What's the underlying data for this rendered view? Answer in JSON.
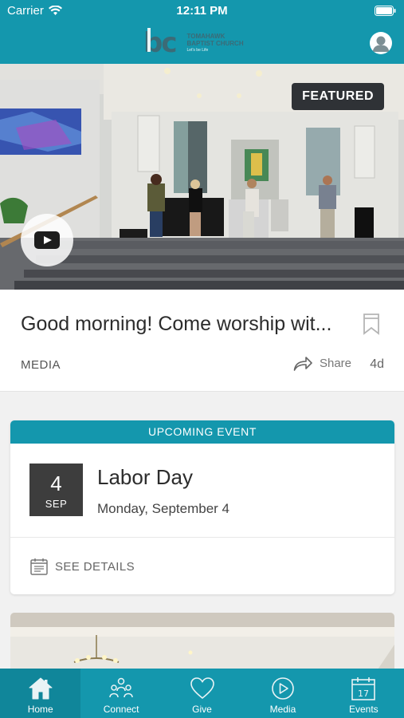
{
  "status": {
    "carrier": "Carrier",
    "time": "12:11 PM"
  },
  "header": {
    "logo_mark": "bc",
    "logo_line1": "TOMAHAWK",
    "logo_line2": "BAPTIST CHURCH",
    "logo_tag": "Let's be Life"
  },
  "featured_post": {
    "badge": "FEATURED",
    "title": "Good morning! Come worship wit...",
    "category": "MEDIA",
    "share_label": "Share",
    "age": "4d"
  },
  "upcoming_event": {
    "header": "UPCOMING EVENT",
    "day": "4",
    "month": "SEP",
    "title": "Labor Day",
    "date": "Monday, September 4",
    "details_label": "SEE DETAILS"
  },
  "tabs": [
    {
      "label": "Home",
      "icon": "home-icon",
      "active": true
    },
    {
      "label": "Connect",
      "icon": "people-icon",
      "active": false
    },
    {
      "label": "Give",
      "icon": "heart-icon",
      "active": false
    },
    {
      "label": "Media",
      "icon": "play-circle-icon",
      "active": false
    },
    {
      "label": "Events",
      "icon": "calendar-icon",
      "active": false
    }
  ],
  "colors": {
    "brand": "#1497ad",
    "dark": "#3d3d3d"
  }
}
